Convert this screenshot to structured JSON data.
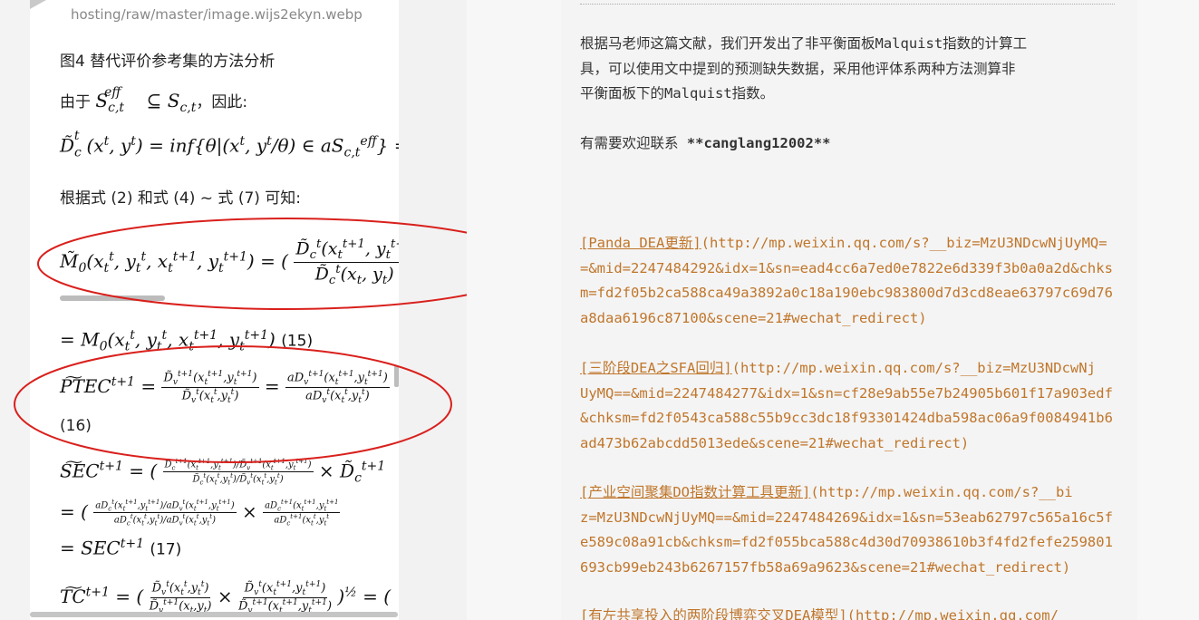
{
  "left": {
    "url_top": "hosting/raw/master/image.wijs2ekyn.webp",
    "figure_caption": "图4 替代评价参考集的方法分析",
    "since_prefix": "由于",
    "since_suffix": "，因此:",
    "from_eq": "根据式 (2) 和式 (4) ~ 式 (7) 可知:",
    "eq15_label": "(15)",
    "eq16_label": "(16)",
    "eq17_label": "(17)",
    "annotation_color": "#d9201c"
  },
  "right": {
    "para1": [
      "根据马老师这篇文献，我们开发出了非平衡面板Malquist指数的计算工",
      "具，可以使用文中提到的预测缺失数据，采用他评体系两种方法测算非",
      "平衡面板下的Malquist指数。"
    ],
    "contact_prefix": "有需要欢迎联系 ",
    "contact_value": "**canglang12002**",
    "links": [
      {
        "lines": [
          "[Panda DEA更新](http://mp.weixin.qq.com/s?__biz=MzU3NDcwNjUyMQ=",
          "=&mid=2247484292&idx=1&sn=ead4cc6a7ed0e7822e6d339f3b0a0a2d&chks",
          "m=fd2f05b2ca588ca49a3892a0c18a190ebc983800d7d3cd8eae63797c69d76",
          "a8daa6196c87100&scene=21#wechat_redirect)"
        ]
      },
      {
        "lines": [
          "[三阶段DEA之SFA回归](http://mp.weixin.qq.com/s?__biz=MzU3NDcwNj",
          "UyMQ==&mid=2247484277&idx=1&sn=cf28e9ab55e7b24905b601f17a903edf",
          "&chksm=fd2f0543ca588c55b9cc3dc18f93301424dba598ac06a9f0084941b6",
          "ad473b62abcdd5013ede&scene=21#wechat_redirect)"
        ]
      },
      {
        "lines": [
          "[产业空间聚集DO指数计算工具更新](http://mp.weixin.qq.com/s?__bi",
          "z=MzU3NDcwNjUyMQ==&mid=2247484269&idx=1&sn=53eab62797c565a16c5f",
          "e589c08a91cb&chksm=fd2f055bca588c4d30d70938610b3f4fd2fefe259801",
          "693cb99eb243b6267157fb58a69a9623&scene=21#wechat_redirect)"
        ]
      }
    ],
    "link_color": "#c0762b"
  }
}
